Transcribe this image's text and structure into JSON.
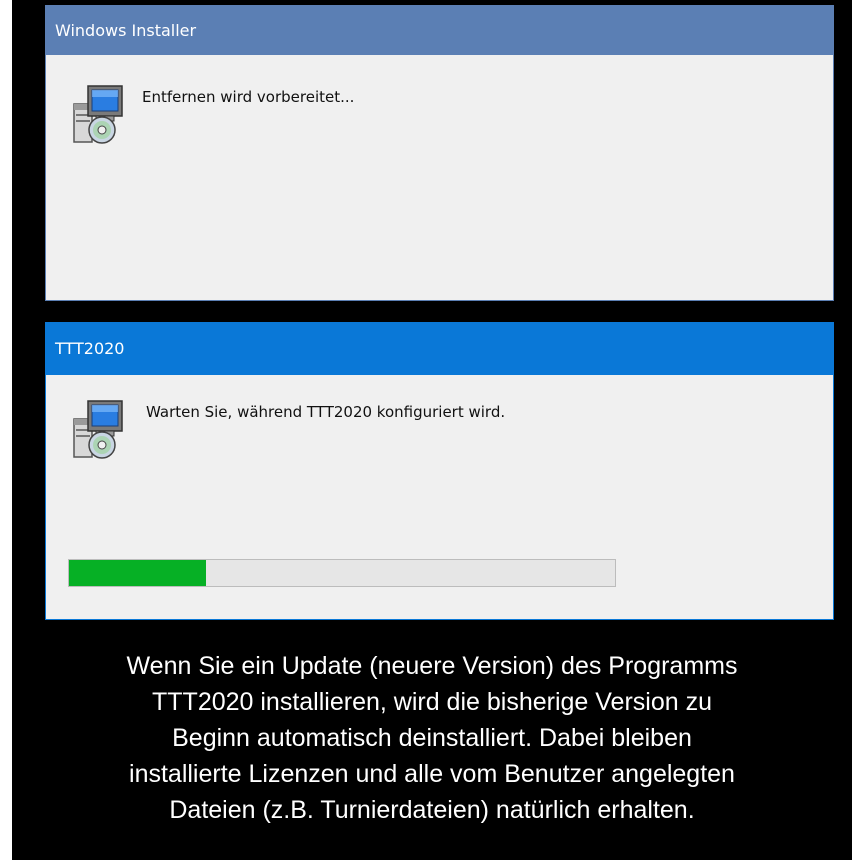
{
  "installer_dialog": {
    "title": "Windows Installer",
    "message": "Entfernen wird vorbereitet...",
    "icon": "installer-package-icon"
  },
  "ttt_dialog": {
    "title": "TTT2020",
    "message": "Warten Sie, während TTT2020 konfiguriert wird.",
    "icon": "installer-package-icon",
    "progress_fraction": 0.25,
    "progress_color": "#06b025"
  },
  "caption": {
    "lines": [
      "Wenn Sie ein Update (neuere Version) des Programms",
      "TTT2020 installieren, wird die bisherige Version zu",
      "Beginn automatisch deinstalliert. Dabei bleiben",
      "installierte Lizenzen und alle vom Benutzer angelegten",
      "Dateien (z.B. Turnierdateien) natürlich erhalten."
    ]
  },
  "colors": {
    "installer_title_bg": "#5b7fb4",
    "ttt_title_bg": "#0a78d7",
    "background": "#000000"
  }
}
